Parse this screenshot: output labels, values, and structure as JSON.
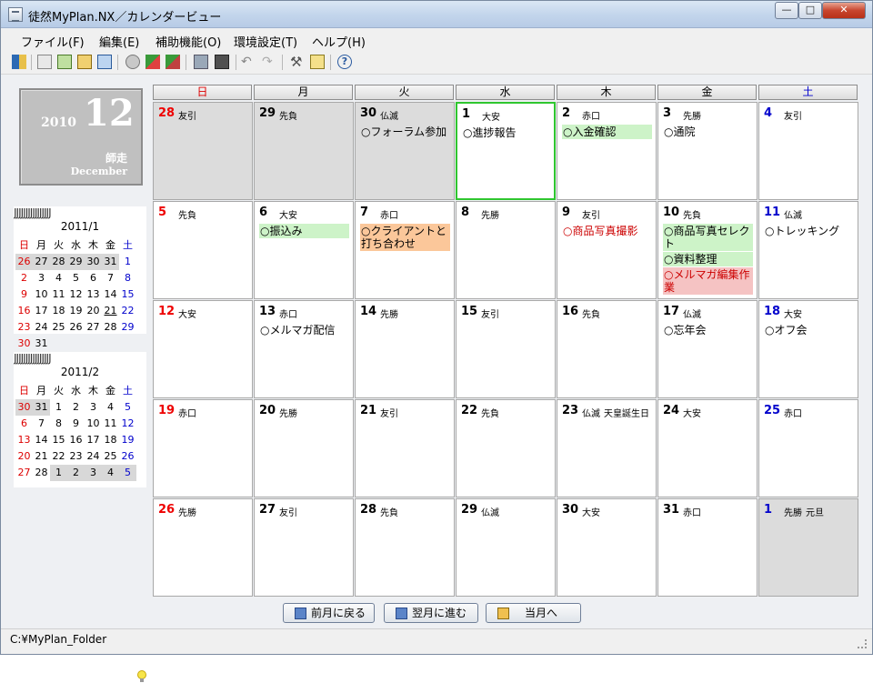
{
  "window": {
    "title": "徒然MyPlan.NX／カレンダービュー"
  },
  "menu": [
    "ファイル(F)",
    "編集(E)",
    "補助機能(O)",
    "環境設定(T)",
    "ヘルプ(H)"
  ],
  "big_date": {
    "year": "2010",
    "month": "12",
    "jp": "師走",
    "en": "December"
  },
  "minical_rings": "JJJJJJJJJJJJJJJJ",
  "minical1": {
    "title": "2011/1",
    "headers": [
      "日",
      "月",
      "火",
      "水",
      "木",
      "金",
      "土"
    ],
    "rows": [
      [
        "26",
        "27",
        "28",
        "29",
        "30",
        "31",
        "1"
      ],
      [
        "2",
        "3",
        "4",
        "5",
        "6",
        "7",
        "8"
      ],
      [
        "9",
        "10",
        "11",
        "12",
        "13",
        "14",
        "15"
      ],
      [
        "16",
        "17",
        "18",
        "19",
        "20",
        "21",
        "22"
      ],
      [
        "23",
        "24",
        "25",
        "26",
        "27",
        "28",
        "29"
      ],
      [
        "30",
        "31",
        "",
        "",
        "",
        "",
        ""
      ]
    ]
  },
  "minical2": {
    "title": "2011/2",
    "headers": [
      "日",
      "月",
      "火",
      "水",
      "木",
      "金",
      "土"
    ],
    "rows": [
      [
        "30",
        "31",
        "1",
        "2",
        "3",
        "4",
        "5"
      ],
      [
        "6",
        "7",
        "8",
        "9",
        "10",
        "11",
        "12"
      ],
      [
        "13",
        "14",
        "15",
        "16",
        "17",
        "18",
        "19"
      ],
      [
        "20",
        "21",
        "22",
        "23",
        "24",
        "25",
        "26"
      ],
      [
        "27",
        "28",
        "1",
        "2",
        "3",
        "4",
        "5"
      ]
    ]
  },
  "calendar": {
    "weekdays": [
      "日",
      "月",
      "火",
      "水",
      "木",
      "金",
      "土"
    ],
    "weeks": [
      [
        {
          "d": "28",
          "rk": "友引"
        },
        {
          "d": "29",
          "rk": "先負"
        },
        {
          "d": "30",
          "rk": "仏滅",
          "ev": [
            "○フォーラム参加"
          ]
        },
        {
          "d": "1",
          "rk": "大安",
          "ev": [
            "○進捗報告"
          ]
        },
        {
          "d": "2",
          "rk": "赤口",
          "ev": [
            "○入金確認"
          ]
        },
        {
          "d": "3",
          "rk": "先勝",
          "ev": [
            "○通院"
          ]
        },
        {
          "d": "4",
          "rk": "友引"
        }
      ],
      [
        {
          "d": "5",
          "rk": "先負"
        },
        {
          "d": "6",
          "rk": "大安",
          "ev": [
            "○振込み"
          ]
        },
        {
          "d": "7",
          "rk": "赤口",
          "ev": [
            "○クライアントと打ち合わせ"
          ]
        },
        {
          "d": "8",
          "rk": "先勝"
        },
        {
          "d": "9",
          "rk": "友引",
          "ev": [
            "○商品写真撮影"
          ]
        },
        {
          "d": "10",
          "rk": "先負",
          "ev": [
            "○商品写真セレクト",
            "○資料整理",
            "○メルマガ編集作業"
          ]
        },
        {
          "d": "11",
          "rk": "仏滅",
          "ev": [
            "○トレッキング"
          ]
        }
      ],
      [
        {
          "d": "12",
          "rk": "大安"
        },
        {
          "d": "13",
          "rk": "赤口",
          "ev": [
            "○メルマガ配信"
          ]
        },
        {
          "d": "14",
          "rk": "先勝"
        },
        {
          "d": "15",
          "rk": "友引"
        },
        {
          "d": "16",
          "rk": "先負"
        },
        {
          "d": "17",
          "rk": "仏滅",
          "ev": [
            "○忘年会"
          ]
        },
        {
          "d": "18",
          "rk": "大安",
          "ev": [
            "○オフ会"
          ]
        }
      ],
      [
        {
          "d": "19",
          "rk": "赤口"
        },
        {
          "d": "20",
          "rk": "先勝"
        },
        {
          "d": "21",
          "rk": "友引"
        },
        {
          "d": "22",
          "rk": "先負"
        },
        {
          "d": "23",
          "rk": "仏滅",
          "rk2": "天皇誕生日"
        },
        {
          "d": "24",
          "rk": "大安"
        },
        {
          "d": "25",
          "rk": "赤口"
        }
      ],
      [
        {
          "d": "26",
          "rk": "先勝"
        },
        {
          "d": "27",
          "rk": "友引"
        },
        {
          "d": "28",
          "rk": "先負"
        },
        {
          "d": "29",
          "rk": "仏滅"
        },
        {
          "d": "30",
          "rk": "大安"
        },
        {
          "d": "31",
          "rk": "赤口"
        },
        {
          "d": "1",
          "rk": "先勝",
          "rk2": "元旦"
        }
      ]
    ]
  },
  "nav": {
    "prev": "前月に戻る",
    "next": "翌月に進む",
    "today": "当月へ"
  },
  "status": {
    "path": "C:¥MyPlan_Folder"
  }
}
